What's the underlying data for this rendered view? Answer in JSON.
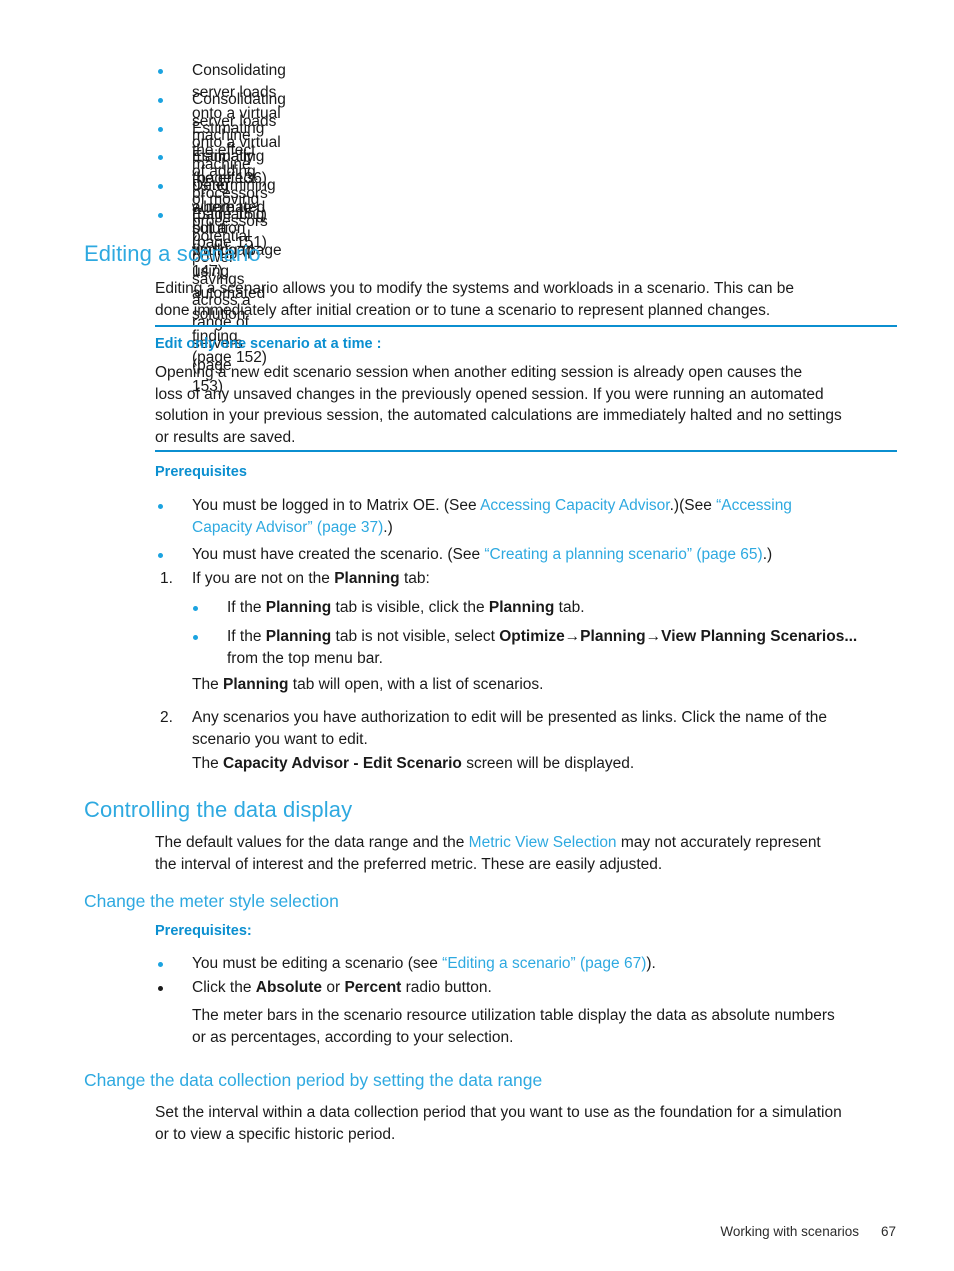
{
  "colors": {
    "heading_blue": "#2ea9e0",
    "link_blue": "#2ea9e0",
    "bold_blue": "#0b8fd0",
    "bullet_blue": "#1ba3e0",
    "rule_blue": "#0b8fd0",
    "text": "#1a1a1a"
  },
  "top_list": {
    "items": [
      "Consolidating server loads onto a virtual machine manually (page 136)",
      "Consolidating server loads onto a virtual machine using automated solution finding (page 147)",
      "Estimating the effect of adding processors (page 151)",
      "Estimating the effect of moving processors (page 151)",
      "Determining where to put a workload using automated solution finding (page 152)",
      "Estimating potential power savings across a range of servers (page 153)"
    ]
  },
  "editing_scenario": {
    "heading": "Editing a scenario",
    "intro_line1": "Editing a scenario allows you to modify the systems and workloads in a scenario. This can be",
    "intro_line2": "done immediately after initial creation or to tune a scenario to represent planned changes.",
    "note": {
      "title": "Edit only one scenario at a time :",
      "line1": "Opening a new edit scenario session when another editing session is already open causes the",
      "line2": "loss of any unsaved changes in the previously opened session. If you were running an automated",
      "line3": "solution in your previous session, the automated calculations are immediately halted and no settings",
      "line4": "or results are saved."
    },
    "prerequisites_heading": "Prerequisites",
    "prereq_1": {
      "pre": "You must be logged in to Matrix OE. (See ",
      "link1": "Accessing Capacity Advisor",
      "mid": ".)(See ",
      "link2_line1": "“Accessing",
      "link2_line2": "Capacity Advisor” (page 37)",
      "post": ".)"
    },
    "prereq_2": {
      "pre": "You must have created the scenario. (See ",
      "link": "“Creating a planning scenario” (page 65)",
      "post": ".)"
    },
    "step1": {
      "number": "1.",
      "pre": "If you are not on the ",
      "bold": "Planning",
      "post": " tab:",
      "sub1": {
        "pre": "If the ",
        "bold1": "Planning",
        "mid": " tab is visible, click the ",
        "bold2": "Planning",
        "post": " tab."
      },
      "sub2": {
        "pre": "If the ",
        "bold1": "Planning",
        "mid": " tab is not visible, select ",
        "bold2": "Optimize→Planning→View Planning Scenarios...",
        "line2": "from the top menu bar."
      },
      "result": {
        "pre": "The ",
        "bold": "Planning",
        "post": " tab will open, with a list of scenarios."
      }
    },
    "step2": {
      "number": "2.",
      "line1": "Any scenarios you have authorization to edit will be presented as links. Click the name of the",
      "line2": "scenario you want to edit.",
      "result": {
        "pre": "The ",
        "bold": "Capacity Advisor - Edit Scenario",
        "post": " screen will be displayed."
      }
    }
  },
  "controlling_data_display": {
    "heading": "Controlling the data display",
    "intro": {
      "pre": "The default values for the data range and the ",
      "link": "Metric View Selection",
      "post": " may not accurately represent",
      "line2": "the interval of interest and the preferred metric. These are easily adjusted."
    },
    "meter_style": {
      "heading": "Change the meter style selection",
      "prerequisites_heading": "Prerequisites:",
      "bullet1": {
        "pre": "You must be editing a scenario (see ",
        "link": "“Editing a scenario” (page 67)",
        "post": ")."
      },
      "bullet2": {
        "pre": "Click the ",
        "bold1": "Absolute",
        "mid": " or ",
        "bold2": "Percent",
        "post": " radio button."
      },
      "result_line1": "The meter bars in the scenario resource utilization table display the data as absolute numbers",
      "result_line2": "or as percentages, according to your selection."
    },
    "data_range": {
      "heading": "Change the data collection period by setting the data range",
      "line1": "Set the interval within a data collection period that you want to use as the foundation for a simulation",
      "line2": "or to view a specific historic period."
    }
  },
  "footer": {
    "chapter": "Working with scenarios",
    "page_number": "67"
  }
}
